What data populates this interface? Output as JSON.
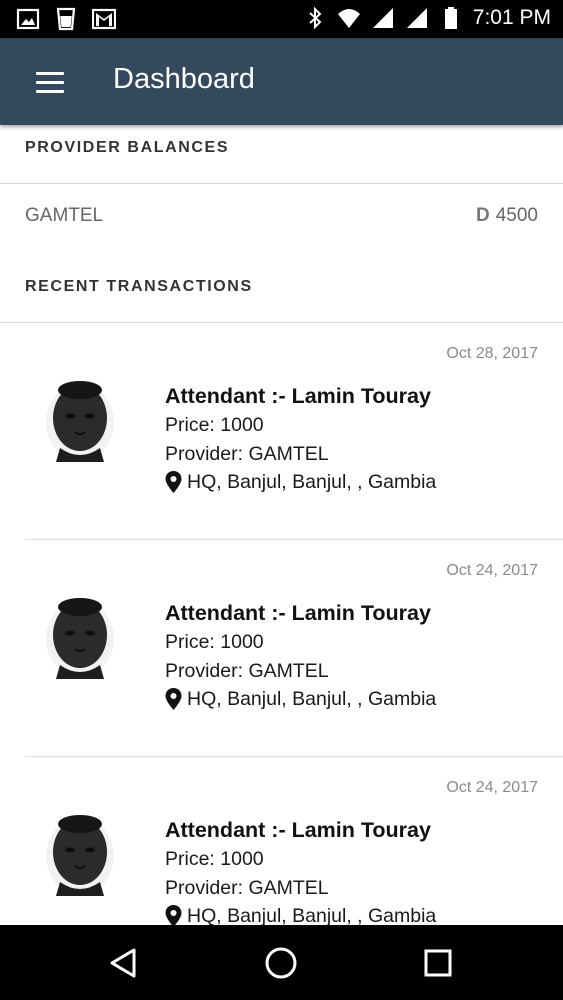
{
  "status_bar": {
    "time": "7:01 PM",
    "icons": [
      "image-icon",
      "glass-icon",
      "gmail-icon",
      "bluetooth-icon",
      "wifi-icon",
      "signal-icon",
      "signal-icon",
      "battery-icon"
    ]
  },
  "app_bar": {
    "title": "Dashboard",
    "menu_icon": "hamburger-menu-icon",
    "color": "#34495e"
  },
  "provider_balances": {
    "header": "PROVIDER BALANCES",
    "items": [
      {
        "name": "GAMTEL",
        "currency": "D",
        "amount": "4500"
      }
    ]
  },
  "recent_transactions": {
    "header": "RECENT TRANSACTIONS",
    "items": [
      {
        "date": "Oct 28, 2017",
        "attendant": "Attendant :- Lamin Touray",
        "price": "Price: 1000",
        "provider": "Provider: GAMTEL",
        "location": "HQ, Banjul, Banjul, , Gambia"
      },
      {
        "date": "Oct 24, 2017",
        "attendant": "Attendant :- Lamin Touray",
        "price": "Price: 1000",
        "provider": "Provider: GAMTEL",
        "location": "HQ, Banjul, Banjul, , Gambia"
      },
      {
        "date": "Oct 24, 2017",
        "attendant": "Attendant :- Lamin Touray",
        "price": "Price: 1000",
        "provider": "Provider: GAMTEL",
        "location": "HQ, Banjul, Banjul, , Gambia"
      }
    ]
  },
  "nav_bar": {
    "icons": [
      "back-triangle-icon",
      "home-circle-icon",
      "recents-square-icon"
    ]
  }
}
